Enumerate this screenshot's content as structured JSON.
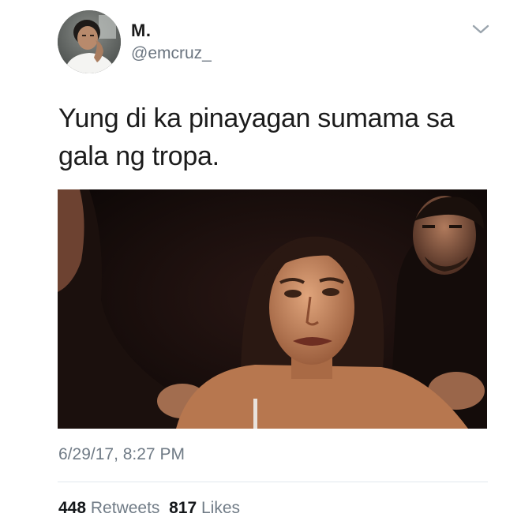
{
  "user": {
    "display_name": "M.",
    "handle": "@emcruz_",
    "avatar_icon": "profile-photo"
  },
  "menu": {
    "icon": "chevron-down-icon"
  },
  "tweet": {
    "text": "Yung di ka pinayagan sumama sa\ngala  ng tropa.",
    "timestamp": "6/29/17, 8:27 PM"
  },
  "stats": {
    "retweets_count": "448",
    "retweets_label": "Retweets",
    "likes_count": "817",
    "likes_label": "Likes"
  },
  "colors": {
    "secondary_text": "#707b86",
    "divider": "#e1e8ed"
  }
}
